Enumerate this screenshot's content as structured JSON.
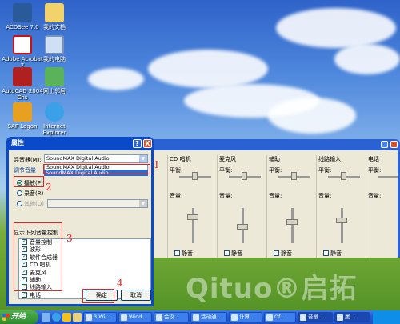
{
  "desktop": {
    "icons": [
      {
        "label": "ACDSee 7.0"
      },
      {
        "label": "我的文档"
      },
      {
        "label": "Adobe Acrobat 7"
      },
      {
        "label": "我的电脑"
      },
      {
        "label": "AutoCAD 2004 Chs"
      },
      {
        "label": "网上邻居"
      },
      {
        "label": "SAP Logon"
      },
      {
        "label": "Internet Explorer"
      }
    ],
    "watermark": "Qituo®启拓"
  },
  "mixer": {
    "columns": [
      {
        "title": "",
        "balance": "",
        "volume": "",
        "mute": ""
      },
      {
        "title": "CD 唱机",
        "balance": "平衡:",
        "volume": "音量:",
        "mute": "静音"
      },
      {
        "title": "麦克风",
        "balance": "平衡:",
        "volume": "音量:",
        "mute": "静音"
      },
      {
        "title": "辅助",
        "balance": "平衡:",
        "volume": "音量:",
        "mute": "静音"
      },
      {
        "title": "线路输入",
        "balance": "平衡:",
        "volume": "音量:",
        "mute": "静音"
      },
      {
        "title": "电话",
        "balance": "平衡:",
        "volume": "音量:",
        "mute": ""
      }
    ]
  },
  "dialog": {
    "title": "属性",
    "help_btn": "?",
    "close_btn": "X",
    "mixer_device_label": "混音器(M):",
    "mixer_device_value": "SoundMAX Digital Audio",
    "dropdown_items": [
      "SoundMAX Digital Audio",
      "SoundMAX Digital Audio"
    ],
    "adjust_label": "调节音量",
    "radio_playback": "播放(P)",
    "radio_record": "录音(R)",
    "radio_other": "其他(O)",
    "show_controls_label": "显示下列音量控制",
    "controls": [
      "音量控制",
      "波形",
      "软件合成器",
      "CD 唱机",
      "麦克风",
      "辅助",
      "线路输入",
      "电话"
    ],
    "ok": "确定",
    "cancel": "取消"
  },
  "annotations": [
    "1",
    "2",
    "3",
    "4"
  ],
  "taskbar": {
    "start": "开始",
    "tasks": [
      "3 Wi...",
      "Wind...",
      "会议...",
      "活动通...",
      "计算...",
      "Of...",
      "音量...",
      "属..."
    ]
  },
  "colors": {
    "annotation": "#e32222",
    "titlebar": "#0a49c8",
    "taskbar": "#245edb"
  }
}
